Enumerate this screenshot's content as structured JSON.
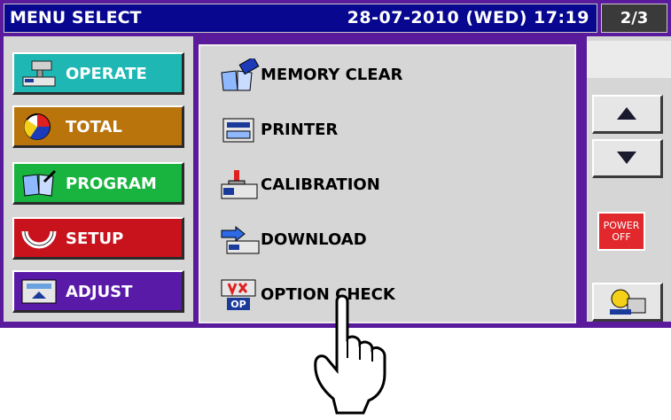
{
  "titlebar": {
    "title": "MENU SELECT",
    "datetime": "28-07-2010 (WED) 17:19",
    "page": "2/3"
  },
  "nav": [
    {
      "label": "OPERATE",
      "icon": "scale-icon",
      "color": "#1fb7b3"
    },
    {
      "label": "TOTAL",
      "icon": "pie-chart-icon",
      "color": "#b9750c"
    },
    {
      "label": "PROGRAM",
      "icon": "book-icon",
      "color": "#19b33f"
    },
    {
      "label": "SETUP",
      "icon": "wrench-icon",
      "color": "#c8121c"
    },
    {
      "label": "ADJUST",
      "icon": "adjust-icon",
      "color": "#5a1aa8"
    }
  ],
  "items": [
    {
      "label": "MEMORY CLEAR",
      "icon": "memory-clear-icon"
    },
    {
      "label": "PRINTER",
      "icon": "printer-icon"
    },
    {
      "label": "CALIBRATION",
      "icon": "calibration-icon"
    },
    {
      "label": "DOWNLOAD",
      "icon": "download-icon"
    },
    {
      "label": "OPTION CHECK",
      "icon": "option-check-icon"
    }
  ],
  "right": {
    "power_label_1": "POWER",
    "power_label_2": "OFF"
  },
  "option_badge": "OP"
}
